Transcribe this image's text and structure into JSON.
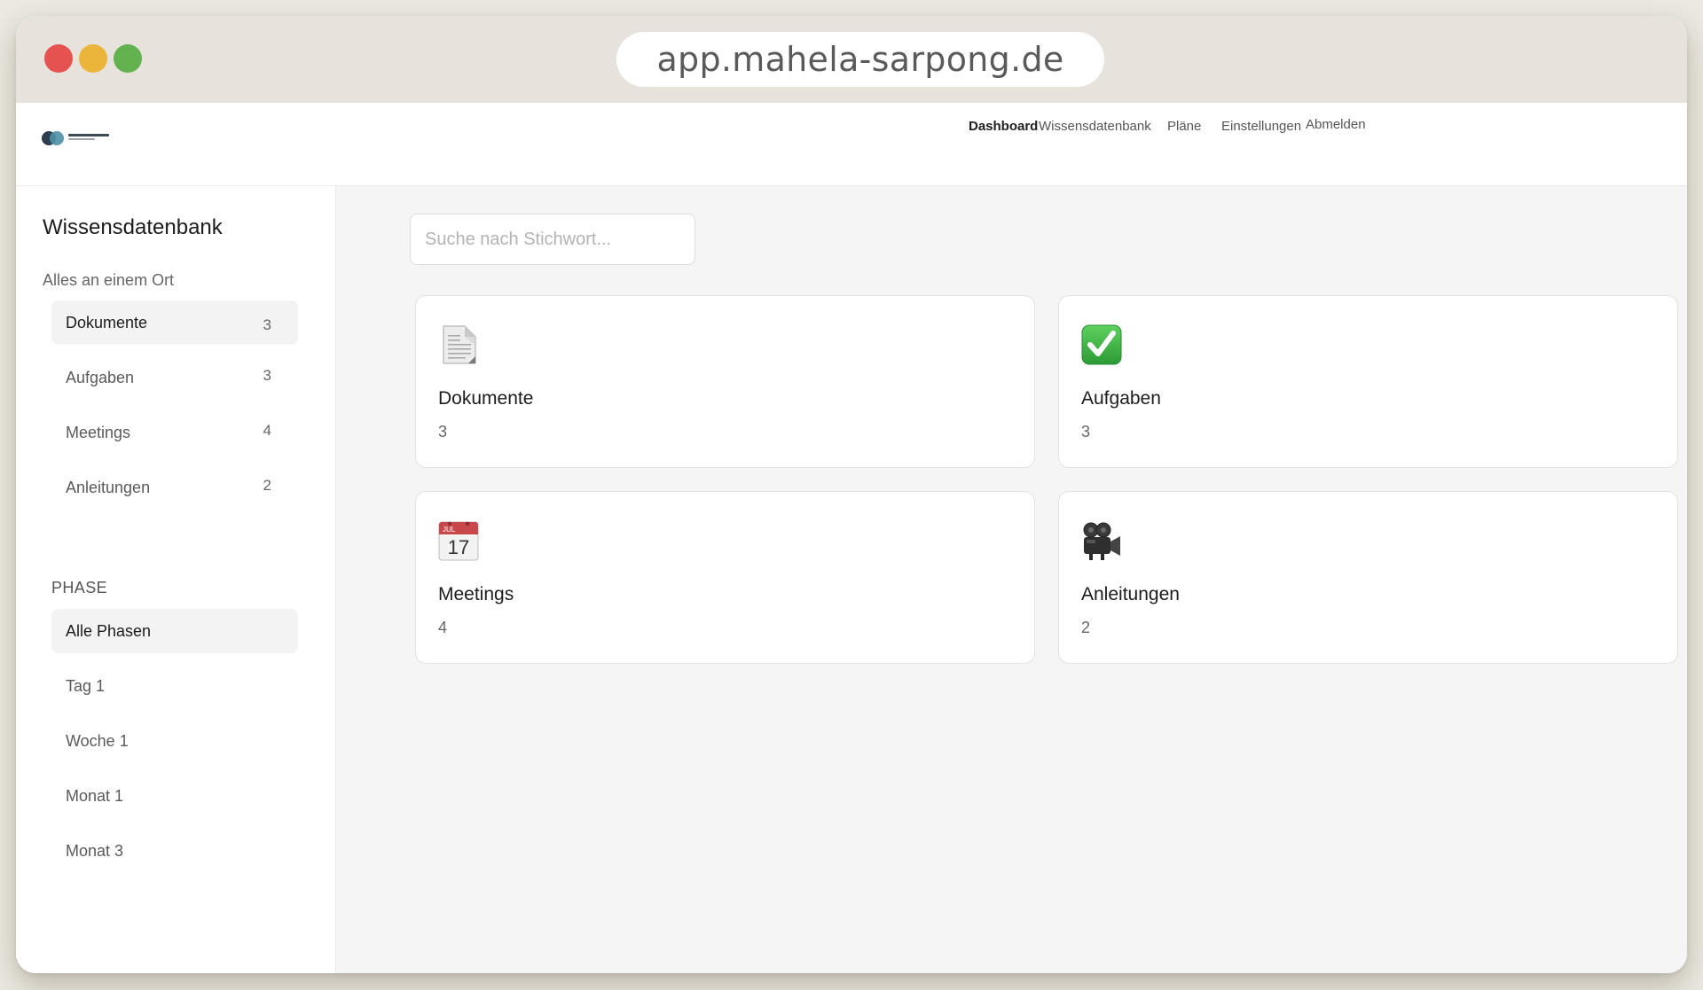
{
  "browser": {
    "url": "app.mahela-sarpong.de"
  },
  "nav": {
    "links": [
      {
        "label": "Dashboard"
      },
      {
        "label": "Wissensdatenbank"
      },
      {
        "label": "Pläne"
      },
      {
        "label": "Einstellungen"
      },
      {
        "label": "Abmelden"
      }
    ],
    "active": "Dashboard"
  },
  "sidebar": {
    "title": "Wissensdatenbank",
    "subtitle": "Alles an einem Ort",
    "categories": [
      {
        "label": "Dokumente",
        "count": "3",
        "active": true
      },
      {
        "label": "Aufgaben",
        "count": "3"
      },
      {
        "label": "Meetings",
        "count": "4"
      },
      {
        "label": "Anleitungen",
        "count": "2"
      }
    ],
    "phase_heading": "PHASE",
    "phases": [
      {
        "label": "Alle Phasen",
        "active": true
      },
      {
        "label": "Tag 1"
      },
      {
        "label": "Woche 1"
      },
      {
        "label": "Monat 1"
      },
      {
        "label": "Monat 3"
      }
    ]
  },
  "search": {
    "placeholder": "Suche nach Stichwort..."
  },
  "cards": [
    {
      "title": "Dokumente",
      "count": "3",
      "icon": "document-icon"
    },
    {
      "title": "Aufgaben",
      "count": "3",
      "icon": "checkmark-icon"
    },
    {
      "title": "Meetings",
      "count": "4",
      "icon": "calendar-icon",
      "icon_month": "JUL",
      "icon_day": "17"
    },
    {
      "title": "Anleitungen",
      "count": "2",
      "icon": "movie-camera-icon"
    }
  ],
  "colors": {
    "traffic_red": "#e5524f",
    "traffic_yellow": "#ebb43a",
    "traffic_green": "#62b24f",
    "check_green": "#3bb54a",
    "calendar_red": "#c8474b"
  }
}
